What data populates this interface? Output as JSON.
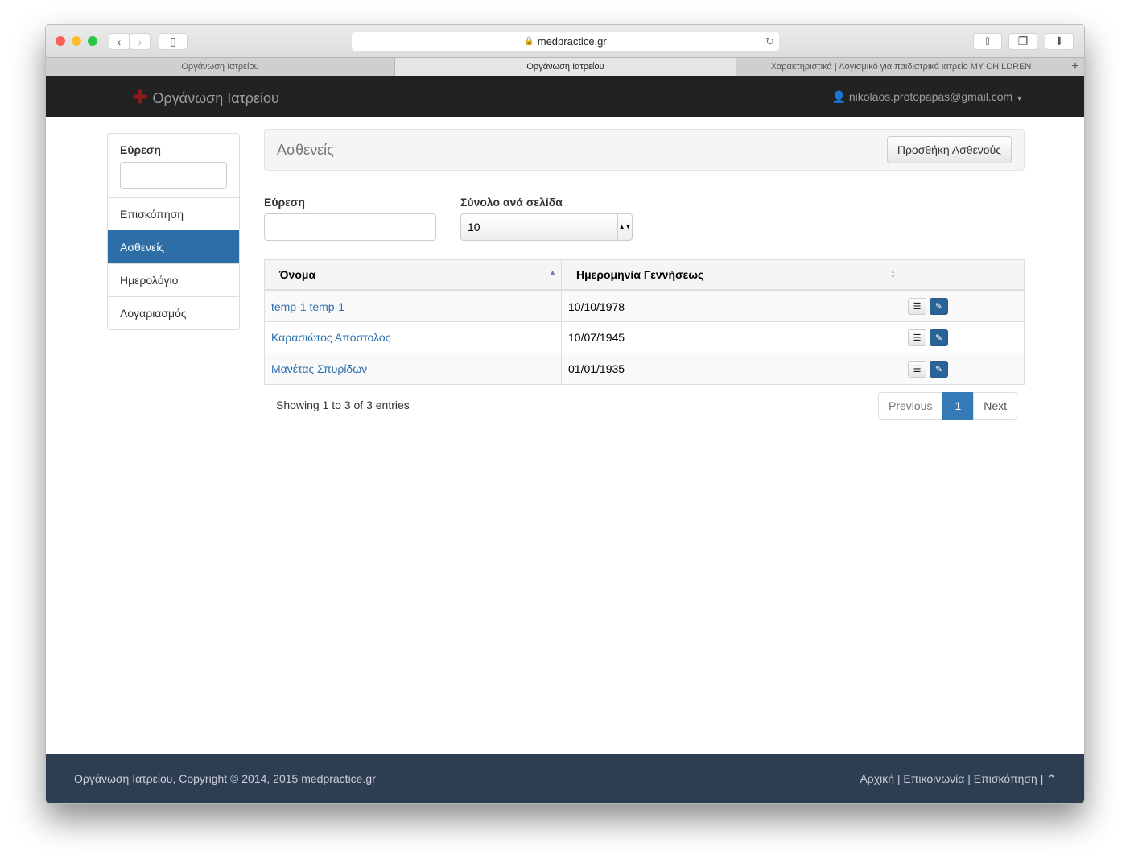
{
  "browser": {
    "url": "medpractice.gr",
    "tabs": [
      "Οργάνωση Ιατρείου",
      "Οργάνωση Ιατρείου",
      "Χαρακτηριστικά | Λογισμικό για παιδιατρικό ιατρείο MY CHILDREN"
    ]
  },
  "navbar": {
    "brand": "Οργάνωση Ιατρείου",
    "user": "nikolaos.protopapas@gmail.com"
  },
  "sidebar": {
    "search_label": "Εύρεση",
    "items": [
      {
        "label": "Επισκόπηση"
      },
      {
        "label": "Ασθενείς"
      },
      {
        "label": "Ημερολόγιο"
      },
      {
        "label": "Λογαριασμός"
      }
    ]
  },
  "main": {
    "title": "Ασθενείς",
    "add_button": "Προσθήκη Ασθενούς",
    "search_label": "Εύρεση",
    "page_size_label": "Σύνολο ανά σελίδα",
    "page_size": "10",
    "columns": [
      "Όνομα",
      "Ημερομηνία Γεννήσεως"
    ],
    "rows": [
      {
        "name": "temp-1 temp-1",
        "dob": "10/10/1978"
      },
      {
        "name": "Καρασιώτος Απόστολος",
        "dob": "10/07/1945"
      },
      {
        "name": "Μανέτας Σπυρίδων",
        "dob": "01/01/1935"
      }
    ],
    "info": "Showing 1 to 3 of 3 entries",
    "prev": "Previous",
    "page": "1",
    "next": "Next"
  },
  "footer": {
    "copyright": "Οργάνωση Ιατρείου, Copyright © 2014, 2015 medpractice.gr",
    "links": [
      "Αρχική",
      "Επικοινωνία",
      "Επισκόπηση"
    ]
  }
}
